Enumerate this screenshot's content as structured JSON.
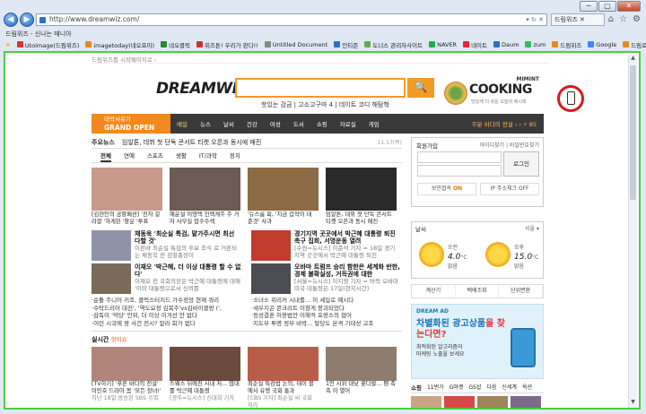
{
  "browser": {
    "address": "http://www.dreamwiz.com/",
    "tab_title": "드림위즈",
    "tab_row_title": "드림위즈 - 신나는 매니아",
    "window_controls": [
      "─",
      "▢",
      "✕"
    ],
    "toolbar_icons": [
      "home-icon",
      "star-icon",
      "gear-icon"
    ]
  },
  "favorites": [
    {
      "label": "Utoimage(드림위즈)",
      "color": "#d33"
    },
    {
      "label": "imagetoday(네오프이)",
      "color": "#e88a1a"
    },
    {
      "label": "네오클릭",
      "color": "#2a8a2a"
    },
    {
      "label": "위즈톤! 우리가 판다!!",
      "color": "#c33"
    },
    {
      "label": "Untitled Document",
      "color": "#888"
    },
    {
      "label": "인티즌",
      "color": "#2d6fc7"
    },
    {
      "label": "도너스 관리자사이트",
      "color": "#6a4"
    },
    {
      "label": "NAVER",
      "color": "#19b04a"
    },
    {
      "label": "네이트",
      "color": "#e23"
    },
    {
      "label": "Daum",
      "color": "#2d6fc7"
    },
    {
      "label": "zum",
      "color": "#3b6"
    },
    {
      "label": "드림위즈",
      "color": "#e88a1a"
    },
    {
      "label": "Google",
      "color": "#4285f4"
    },
    {
      "label": "드림로드",
      "color": "#e88a1a"
    }
  ],
  "page": {
    "topline": "드림위즈를 시작페이지로 ›",
    "logo": "DREAMWIZ",
    "search_button": "🔍",
    "hot_keywords": "핫있는 감금 | 고소고구마 4 | 데이트 코디 해탐혁",
    "mimint": {
      "t1": "MIMINT",
      "t2": "COOKING",
      "t3": "맛있게 더 쉬운 오늘의 레시피"
    },
    "highlight_device": "📱",
    "grand_open": {
      "line1": "대박서유기",
      "line2": "GRAND OPEN"
    },
    "menu": [
      "메일",
      "뉴스",
      "날씨",
      "건강",
      "여성",
      "도서",
      "쇼핑",
      "자료실",
      "게임"
    ],
    "menu_right": "주분 바다의 전설",
    "menu_right2": "85",
    "news_head": {
      "title": "주요뉴스",
      "headline": "임알톤, 데뷔 첫 단독 콘서트 티켓 오픈과 동시에 매진",
      "date": "11.17(목)"
    },
    "news_tabs": [
      "전체",
      "연예",
      "스포츠",
      "생활",
      "IT/과학",
      "정치"
    ],
    "thumbs": [
      {
        "cap": "[김현인의 공항패션] '진자 갈라깔 '하게된 '항운 '투표",
        "color": "#c79a8b"
      },
      {
        "cap": "혜윤설 이영택 진핵계주 주 거자 사무실 압수수색",
        "color": "#6c5a55"
      },
      {
        "cap": "'뉴스룸 회, '지금 갑작이 대 준것' 사과",
        "color": "#8b6c45"
      },
      {
        "cap": "임알톤, 데뷔 첫 단독 콘서트 티켓 오픈과 동시 매진",
        "color": "#2a2a2a"
      }
    ],
    "blocks": [
      {
        "title": "채동욱 '최순실 특검, 맡가주시면 최선 다할 것'",
        "sub": "이른바 최순실 특검의 후보 조식 로 거론되는 채동욱 전 검찰총장이",
        "color": "#8f93a8"
      },
      {
        "title": "경기지역 곳곳에서 박근혜 대통령 퇴진 촉구 집회, 서명운동 열려",
        "sub": "[수원=뉴시스] 이준석 기자 = 18일 경기 지역 곳곳에서 박근혜 대통령 퇴진",
        "color": "#c23b2f"
      },
      {
        "title": "이재오 '박근혜, 더 이상 대통령 할 수 없다'",
        "sub": "이재오 전 국회의장은 박근혜 대통령에 대해 '이미 대통령으로서 신뢰를",
        "color": "#7a6a5a"
      },
      {
        "title": "오바마 트럼프 승리 함한은 세계화 반한, 경제 불확실성, 거득권에 대한",
        "sub": "[서울=뉴시스] 이지영 기자 = 버락 오바마 미국 대통령은 17일(현지시간)",
        "color": "#4b4d52"
      }
    ],
    "list_left": [
      "·순돌 주니어 키조, 클럭스터지드 가수정앙 현재 쿼리",
      "·수탁드리어 대진', '역도요정 김복주'vs김바이클랑 (',",
      "·감독이 '악당' 안위, 더 이상 이겨선 안 없다",
      "·이런 시국에 왕 사건 전시? 말라 회가 없다"
    ],
    "list_right": [
      "·소녀소 위리커 시내를... 이 세일로 예시다",
      "·새우지곤 콘크리트 이향게 붕괴되었다",
      "·동성결혼 허용법안 이해적 프랑스의 협어",
      "·지도부 투명 정부 비박... 탈당도 본격 기대성 고조"
    ],
    "live": {
      "label": "실시간",
      "sub": "핫이슈"
    },
    "thumbs2": [
      {
        "cap": "[TV하기] '푸른 바다의 전설' 이민호 드라마 몸 '모든 장녀!'",
        "color": "#b1867a"
      },
      {
        "cap": "스웨스 뒤에진 시내 처... 엽대를 박근혜 대통령",
        "color": "#6b4a3c"
      },
      {
        "cap": "최순실 특검법 논의, 테이 블에서 유령 국회 통과",
        "color": "#b85d48"
      },
      {
        "cap": "1인 시위 대낮 꽃다발... 팬 축축 이 열어",
        "color": "#8e7d6c"
      }
    ],
    "thumbs2_sub": [
      "지난 18일 방송된 SBS 수목",
      "[광주=뉴시스] 신대희 기자",
      "[CBS 기자] 최순실 씨 국회 처리",
      ""
    ],
    "login": {
      "title": "회원가입",
      "help": "아이디찾기 | 비밀번호찾기",
      "button": "로그인",
      "secure": "보안접속",
      "secure_state": "ON",
      "ipcheck": "IP 주소체크",
      "ipstate": "OFF"
    },
    "weather": {
      "label": "날씨",
      "region": "서울 ▾",
      "am_label": "오전",
      "am": "4.0",
      "pm_label": "오후",
      "pm": "15.0",
      "unit": "°C",
      "cond": "맑음"
    },
    "tools": [
      "계산기",
      "택배조회",
      "단위변환"
    ],
    "ad": {
      "label": "DREAM AD",
      "h1": "차별화된 광고상품",
      "h2": "을 찾는다면?",
      "s1": "최적화된 알고리즘이",
      "s2": "마케팅 노출을 보세요"
    },
    "shop": {
      "title": "쇼핑",
      "items": [
        "11번가",
        "G마켓",
        "GS샵",
        "다음",
        "신세계",
        "옥션"
      ]
    }
  }
}
